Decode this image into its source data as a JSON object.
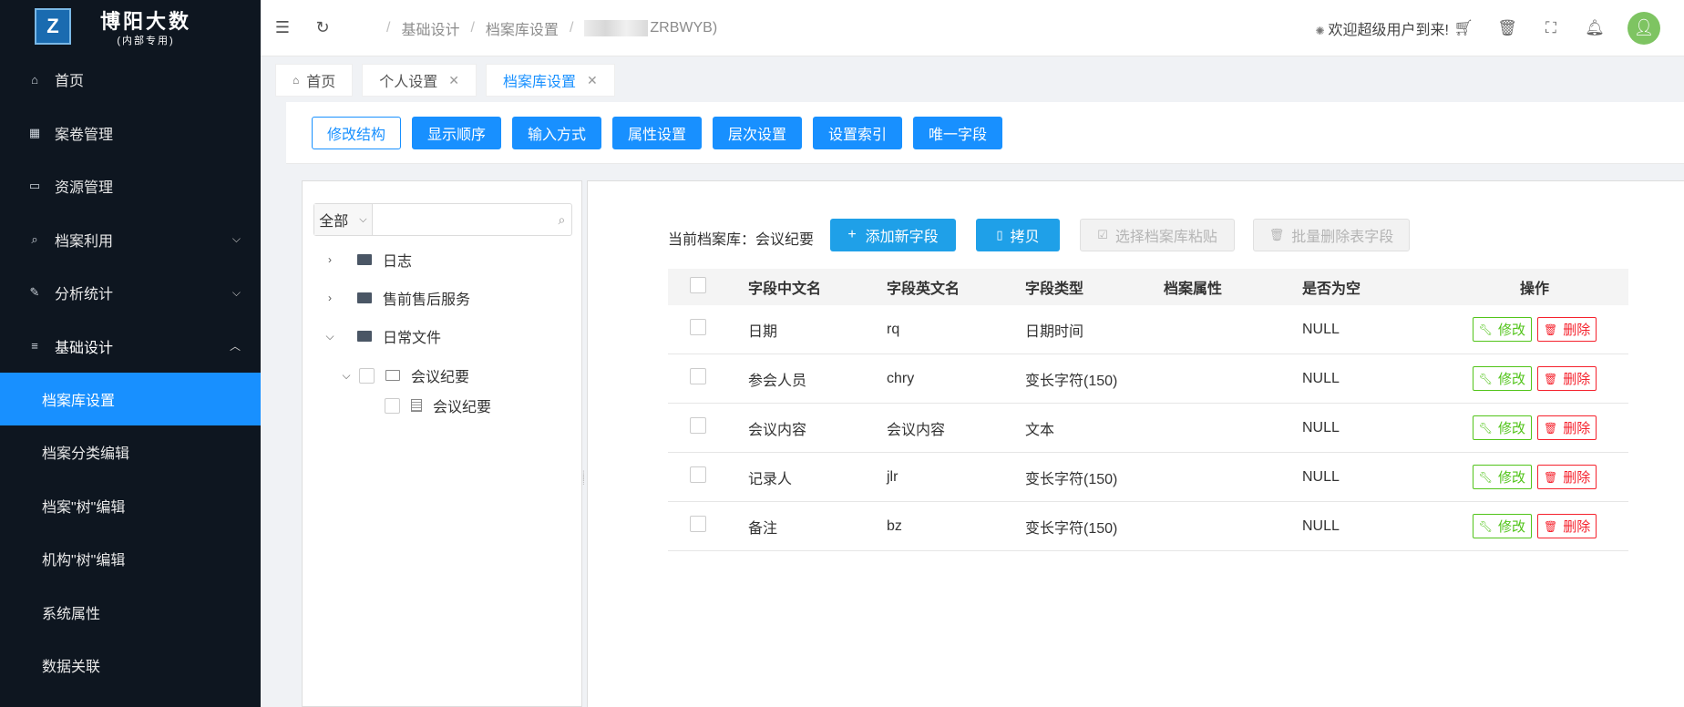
{
  "brand": {
    "logo_letter": "Z",
    "title": "博阳大数",
    "subtitle": "(内部专用)"
  },
  "sidebar": {
    "items": [
      {
        "label": "首页",
        "icon": "home-icon"
      },
      {
        "label": "案卷管理",
        "icon": "grid-icon"
      },
      {
        "label": "资源管理",
        "icon": "folder-icon"
      },
      {
        "label": "档案利用",
        "icon": "search-icon"
      },
      {
        "label": "分析统计",
        "icon": "edit-icon"
      },
      {
        "label": "基础设计",
        "icon": "menu-icon"
      }
    ],
    "subitems": [
      "档案库设置",
      "档案分类编辑",
      "档案\"树\"编辑",
      "机构\"树\"编辑",
      "系统属性",
      "数据关联"
    ]
  },
  "topbar": {
    "breadcrumbs": [
      "基础设计",
      "档案库设置",
      "ZRBWYB)"
    ],
    "welcome": "欢迎超级用户到来!"
  },
  "tabs": [
    {
      "label": "首页"
    },
    {
      "label": "个人设置"
    },
    {
      "label": "档案库设置"
    }
  ],
  "toolbar": [
    "修改结构",
    "显示顺序",
    "输入方式",
    "属性设置",
    "层次设置",
    "设置索引",
    "唯一字段"
  ],
  "tree": {
    "filter_selected": "全部",
    "search_placeholder": "",
    "nodes": [
      "日志",
      "售前售后服务",
      "日常文件",
      "会议纪要",
      "会议纪要"
    ]
  },
  "detail": {
    "current_label": "当前档案库：会议纪要",
    "buttons": {
      "add": "添加新字段",
      "copy": "拷贝",
      "paste": "选择档案库粘贴",
      "batch_delete": "批量删除表字段"
    },
    "columns": [
      "字段中文名",
      "字段英文名",
      "字段类型",
      "档案属性",
      "是否为空",
      "操作"
    ],
    "rows": [
      {
        "cn": "日期",
        "en": "rq",
        "type": "日期时间",
        "attr": "",
        "nullable": "NULL"
      },
      {
        "cn": "参会人员",
        "en": "chry",
        "type": "变长字符(150)",
        "attr": "",
        "nullable": "NULL"
      },
      {
        "cn": "会议内容",
        "en": "会议内容",
        "type": "文本",
        "attr": "",
        "nullable": "NULL"
      },
      {
        "cn": "记录人",
        "en": "jlr",
        "type": "变长字符(150)",
        "attr": "",
        "nullable": "NULL"
      },
      {
        "cn": "备注",
        "en": "bz",
        "type": "变长字符(150)",
        "attr": "",
        "nullable": "NULL"
      }
    ],
    "edit_label": "修改",
    "delete_label": "删除"
  },
  "colors": {
    "primary": "#1890ff",
    "sidebar_bg": "#0e1620",
    "success": "#52c41a",
    "danger": "#f5222d"
  }
}
